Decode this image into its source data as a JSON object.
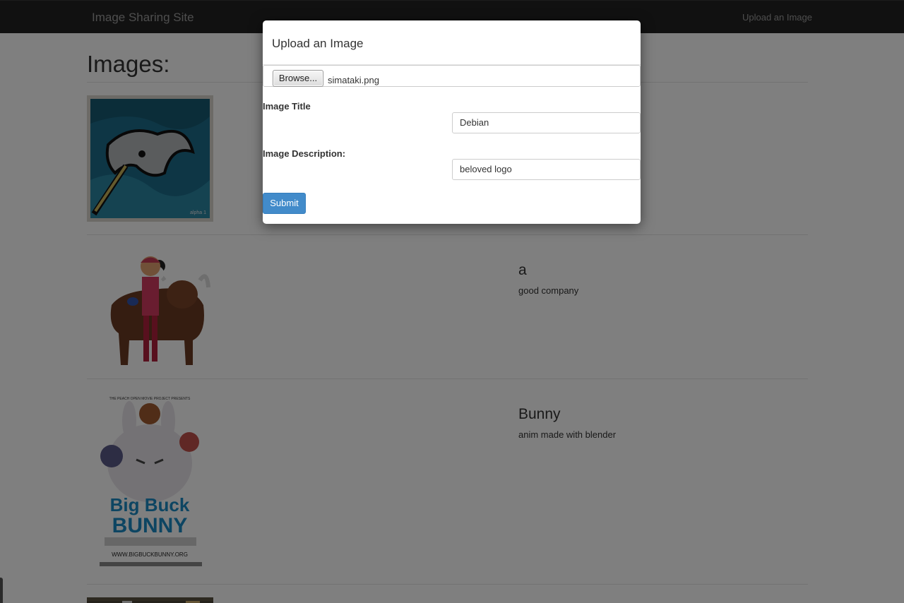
{
  "navbar": {
    "brand": "Image Sharing Site",
    "upload_link": "Upload an Image"
  },
  "page": {
    "title": "Images:"
  },
  "entries": [
    {
      "title": "",
      "description": "",
      "image": "narwhal-painting"
    },
    {
      "title": "a",
      "description": "good company",
      "image": "anime-girl-with-gnu-and-penguin"
    },
    {
      "title": "Bunny",
      "description": "anim made with blender",
      "image": "big-buck-bunny-poster"
    },
    {
      "title": "",
      "description": "",
      "image": "partially-visible-image"
    }
  ],
  "modal": {
    "title": "Upload an Image",
    "browse_label": "Browse...",
    "file_name": "simataki.png",
    "title_label": "Image Title",
    "title_value": "Debian",
    "description_label": "Image Description:",
    "description_value": "beloved logo",
    "submit_label": "Submit"
  },
  "colors": {
    "navbar_bg": "#222222",
    "primary_button": "#428bca",
    "backdrop": "rgba(0,0,0,0.5)"
  },
  "image_texts": {
    "narwhal_signature": "alpha 1",
    "bunny_poster_top": "THE PEACH OPEN MOVIE PROJECT PRESENTS",
    "bunny_poster_title_1": "Big Buck",
    "bunny_poster_title_2": "BUNNY",
    "bunny_poster_url": "WWW.BIGBUCKBUNNY.ORG"
  }
}
